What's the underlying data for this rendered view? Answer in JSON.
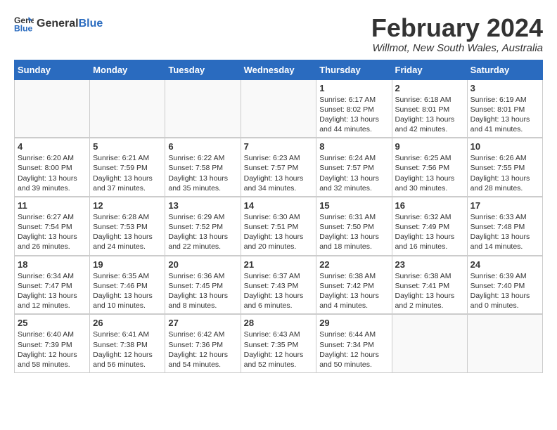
{
  "header": {
    "logo_general": "General",
    "logo_blue": "Blue",
    "month_year": "February 2024",
    "location": "Willmot, New South Wales, Australia"
  },
  "days_of_week": [
    "Sunday",
    "Monday",
    "Tuesday",
    "Wednesday",
    "Thursday",
    "Friday",
    "Saturday"
  ],
  "weeks": [
    [
      {
        "day": "",
        "info": ""
      },
      {
        "day": "",
        "info": ""
      },
      {
        "day": "",
        "info": ""
      },
      {
        "day": "",
        "info": ""
      },
      {
        "day": "1",
        "info": "Sunrise: 6:17 AM\nSunset: 8:02 PM\nDaylight: 13 hours\nand 44 minutes."
      },
      {
        "day": "2",
        "info": "Sunrise: 6:18 AM\nSunset: 8:01 PM\nDaylight: 13 hours\nand 42 minutes."
      },
      {
        "day": "3",
        "info": "Sunrise: 6:19 AM\nSunset: 8:01 PM\nDaylight: 13 hours\nand 41 minutes."
      }
    ],
    [
      {
        "day": "4",
        "info": "Sunrise: 6:20 AM\nSunset: 8:00 PM\nDaylight: 13 hours\nand 39 minutes."
      },
      {
        "day": "5",
        "info": "Sunrise: 6:21 AM\nSunset: 7:59 PM\nDaylight: 13 hours\nand 37 minutes."
      },
      {
        "day": "6",
        "info": "Sunrise: 6:22 AM\nSunset: 7:58 PM\nDaylight: 13 hours\nand 35 minutes."
      },
      {
        "day": "7",
        "info": "Sunrise: 6:23 AM\nSunset: 7:57 PM\nDaylight: 13 hours\nand 34 minutes."
      },
      {
        "day": "8",
        "info": "Sunrise: 6:24 AM\nSunset: 7:57 PM\nDaylight: 13 hours\nand 32 minutes."
      },
      {
        "day": "9",
        "info": "Sunrise: 6:25 AM\nSunset: 7:56 PM\nDaylight: 13 hours\nand 30 minutes."
      },
      {
        "day": "10",
        "info": "Sunrise: 6:26 AM\nSunset: 7:55 PM\nDaylight: 13 hours\nand 28 minutes."
      }
    ],
    [
      {
        "day": "11",
        "info": "Sunrise: 6:27 AM\nSunset: 7:54 PM\nDaylight: 13 hours\nand 26 minutes."
      },
      {
        "day": "12",
        "info": "Sunrise: 6:28 AM\nSunset: 7:53 PM\nDaylight: 13 hours\nand 24 minutes."
      },
      {
        "day": "13",
        "info": "Sunrise: 6:29 AM\nSunset: 7:52 PM\nDaylight: 13 hours\nand 22 minutes."
      },
      {
        "day": "14",
        "info": "Sunrise: 6:30 AM\nSunset: 7:51 PM\nDaylight: 13 hours\nand 20 minutes."
      },
      {
        "day": "15",
        "info": "Sunrise: 6:31 AM\nSunset: 7:50 PM\nDaylight: 13 hours\nand 18 minutes."
      },
      {
        "day": "16",
        "info": "Sunrise: 6:32 AM\nSunset: 7:49 PM\nDaylight: 13 hours\nand 16 minutes."
      },
      {
        "day": "17",
        "info": "Sunrise: 6:33 AM\nSunset: 7:48 PM\nDaylight: 13 hours\nand 14 minutes."
      }
    ],
    [
      {
        "day": "18",
        "info": "Sunrise: 6:34 AM\nSunset: 7:47 PM\nDaylight: 13 hours\nand 12 minutes."
      },
      {
        "day": "19",
        "info": "Sunrise: 6:35 AM\nSunset: 7:46 PM\nDaylight: 13 hours\nand 10 minutes."
      },
      {
        "day": "20",
        "info": "Sunrise: 6:36 AM\nSunset: 7:45 PM\nDaylight: 13 hours\nand 8 minutes."
      },
      {
        "day": "21",
        "info": "Sunrise: 6:37 AM\nSunset: 7:43 PM\nDaylight: 13 hours\nand 6 minutes."
      },
      {
        "day": "22",
        "info": "Sunrise: 6:38 AM\nSunset: 7:42 PM\nDaylight: 13 hours\nand 4 minutes."
      },
      {
        "day": "23",
        "info": "Sunrise: 6:38 AM\nSunset: 7:41 PM\nDaylight: 13 hours\nand 2 minutes."
      },
      {
        "day": "24",
        "info": "Sunrise: 6:39 AM\nSunset: 7:40 PM\nDaylight: 13 hours\nand 0 minutes."
      }
    ],
    [
      {
        "day": "25",
        "info": "Sunrise: 6:40 AM\nSunset: 7:39 PM\nDaylight: 12 hours\nand 58 minutes."
      },
      {
        "day": "26",
        "info": "Sunrise: 6:41 AM\nSunset: 7:38 PM\nDaylight: 12 hours\nand 56 minutes."
      },
      {
        "day": "27",
        "info": "Sunrise: 6:42 AM\nSunset: 7:36 PM\nDaylight: 12 hours\nand 54 minutes."
      },
      {
        "day": "28",
        "info": "Sunrise: 6:43 AM\nSunset: 7:35 PM\nDaylight: 12 hours\nand 52 minutes."
      },
      {
        "day": "29",
        "info": "Sunrise: 6:44 AM\nSunset: 7:34 PM\nDaylight: 12 hours\nand 50 minutes."
      },
      {
        "day": "",
        "info": ""
      },
      {
        "day": "",
        "info": ""
      }
    ]
  ]
}
